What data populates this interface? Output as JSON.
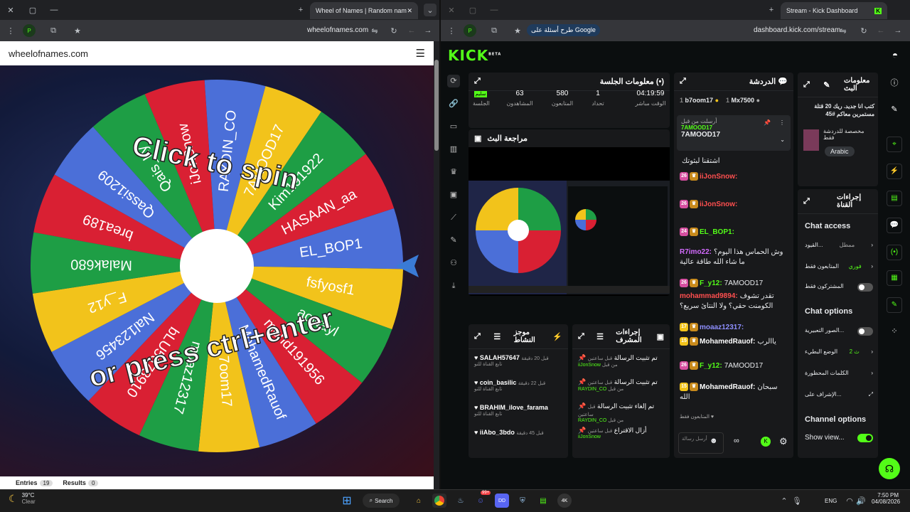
{
  "left_browser": {
    "tab_title": "Wheel of Names | Random nam",
    "url": "wheelofnames.com",
    "site_title": "wheelofnames.com",
    "wheel": {
      "center_text_top": "Click to spin",
      "center_text_bottom": "or press ctrl+enter",
      "names": [
        "Qais_Ly",
        "iJonSnow",
        "RAYDIN_CO",
        "7AMOOD17",
        "Kim191922",
        "HASAAN_aa",
        "EL_BOP1",
        "fsfyosf1",
        "aowayl",
        "mohd191956",
        "MohamedRauof",
        "7oom17",
        "moaz12317",
        "bLU5678910",
        "Nal123456",
        "F_y12",
        "Malak680",
        "brea189",
        "Qassi1209"
      ],
      "colors": [
        "#1e9e45",
        "#d92033",
        "#4b6fd8",
        "#f2c31b"
      ]
    },
    "bottom_tabs": [
      {
        "label": "Entries",
        "count": "19"
      },
      {
        "label": "Results",
        "count": "0"
      }
    ]
  },
  "right_browser": {
    "tab_title": "Stream - Kick Dashboard",
    "url": "dashboard.kick.com/stream",
    "google_chip": "طرح أسئلة على Google",
    "logo": "KICK",
    "logo_beta": "BETA"
  },
  "session": {
    "title": "معلومات الجلسة",
    "live_badge": "سليم",
    "live_label": "الجلسة",
    "stats": [
      {
        "value": "63",
        "label": "المشاهدون"
      },
      {
        "value": "580",
        "label": "المتابعون"
      },
      {
        "value": "1",
        "label": "تحداد"
      },
      {
        "value": "04:19:59",
        "label": "الوقت مباشر"
      }
    ]
  },
  "preview": {
    "title": "مراجعة البث"
  },
  "chat": {
    "title": "الدردشة",
    "top_users": [
      {
        "name": "b7oom17",
        "rank": "1"
      },
      {
        "name": "Mx7500",
        "rank": "1"
      }
    ],
    "pinned": {
      "label": "أرسلت من قبل",
      "user": "7AMOOD17",
      "text": "7AMOOD17"
    },
    "messages": [
      {
        "badge": "",
        "user": "",
        "text": "اشتقنا لبثوتك",
        "color": "#e8eaed"
      },
      {
        "badge": "26",
        "user": "iiJonSnow:",
        "text": "",
        "color": "#ff4f4f"
      },
      {
        "badge": "26",
        "user": "iiJonSnow:",
        "text": "",
        "color": "#ff4f4f"
      },
      {
        "badge": "24",
        "user": "EL_BOP1:",
        "text": "",
        "color": "#53fc18"
      },
      {
        "badge": "",
        "user": "R7imo22:",
        "text": "وش الحماس هذا اليوم؟ ما شاء الله طاقة عالية",
        "color": "#d46bff"
      },
      {
        "badge": "26",
        "user": "F_y12:",
        "text": "7AMOOD17",
        "color": "#53fc18"
      },
      {
        "badge": "",
        "user": "mohammad9894:",
        "text": "تقدر تشوف الكومنت حقي؟ ولا النتائ سريع؟",
        "color": "#ff4f4f"
      },
      {
        "badge": "17",
        "user": "moaaz12317:",
        "text": "",
        "color": "#8f8fff"
      },
      {
        "badge": "15",
        "user": "MohamedRauof:",
        "text": "ياالرب",
        "color": "#ffffff"
      },
      {
        "badge": "26",
        "user": "F_y12:",
        "text": "7AMOOD17",
        "color": "#53fc18"
      },
      {
        "badge": "15",
        "user": "MohamedRauof:",
        "text": "سبحان الله",
        "color": "#ffffff"
      }
    ],
    "followers_only": "المتابعون فقط",
    "input_placeholder": "أرسل رسالة"
  },
  "stream_info": {
    "title": "معلومات البث",
    "stream_title": "كتب انا جديد. ريك 20 قتلة مستمرين معاكم #45",
    "category": "مخصصة للدردشة فقط",
    "language": "Arabic"
  },
  "channel_actions": {
    "title": "إجراءات القناة",
    "chat_access": "Chat access",
    "rows": [
      {
        "label": "القيود...",
        "value": "ممطل"
      },
      {
        "label": "المتابعون فقط",
        "value": "فوري"
      },
      {
        "label": "المشتركون فقط",
        "value": ""
      }
    ],
    "chat_options": "Chat options",
    "option_rows": [
      {
        "label": "الصور التعبيرية..."
      },
      {
        "label": "الوضع البطيء",
        "value": "2 ث"
      },
      {
        "label": "الكلمات المحظورة"
      },
      {
        "label": "الإشراف على..."
      }
    ],
    "channel_options": "Channel options",
    "show_view": "Show view..."
  },
  "mod_actions": {
    "title": "إجراءات المشرف",
    "items": [
      {
        "title": "تم تثبيت الرسالة",
        "by": "iiJonSnow",
        "suffix": "من قبل",
        "time": "قبل ساعتين"
      },
      {
        "title": "تم تثبيت الرسالة",
        "by": "RAYDIN_CO",
        "suffix": "من قبل",
        "time": "قبل ساعتين"
      },
      {
        "title": "تم إلغاء تثبيت الرسالة",
        "by": "RAYDIN_CO",
        "suffix": "من قبل",
        "time": "قبل ساعتين"
      },
      {
        "title": "أزال الاقتراع",
        "by": "iiJonSnow",
        "suffix": "",
        "time": "قبل ساعتين"
      }
    ]
  },
  "activity": {
    "title": "موجز النشاط",
    "items": [
      {
        "user": "SALAH57647",
        "sub": "تابع القناة للتو",
        "time": "قبل 20 دقيقة"
      },
      {
        "user": "coin_basilic",
        "sub": "تابع القناة للتو",
        "time": "قبل 22 دقيقة"
      },
      {
        "user": "BRAHIM_ilove_farama",
        "sub": "تابع القناة للتو",
        "time": ""
      },
      {
        "user": "iiAbo_3bdo",
        "sub": "",
        "time": "قبل 45 دقيقة"
      }
    ]
  },
  "taskbar": {
    "weather_temp": "39°C",
    "weather_desc": "Clear",
    "search": "Search",
    "lang": "ENG",
    "time": "7:50 PM",
    "date": "04/08/2026",
    "discord_badge": "99+"
  }
}
